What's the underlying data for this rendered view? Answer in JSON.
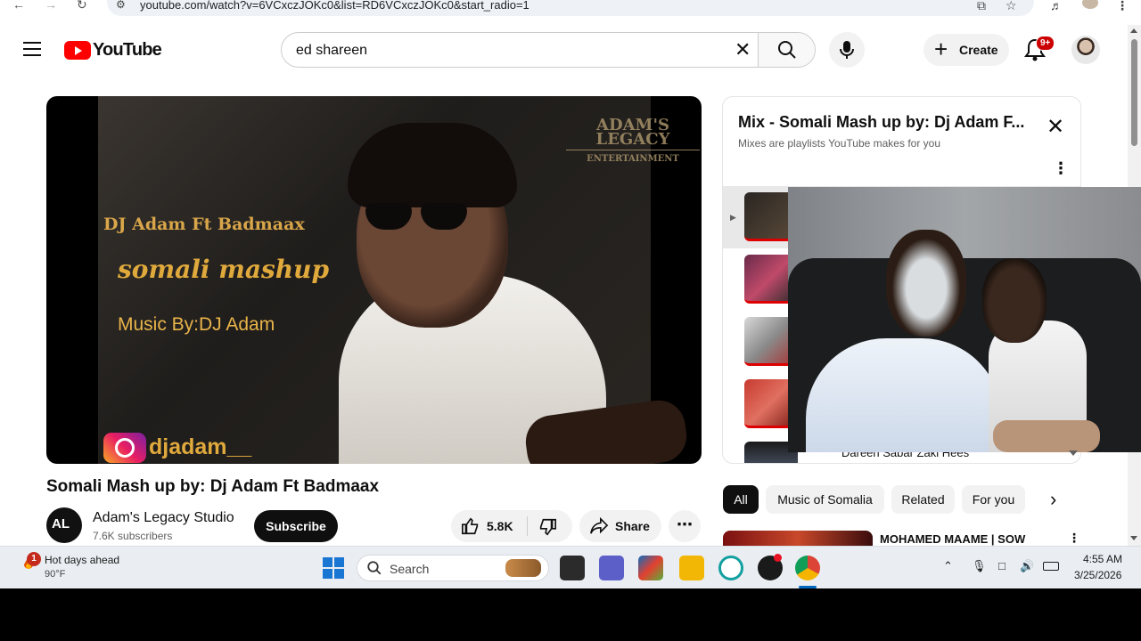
{
  "browser": {
    "url": "youtube.com/watch?v=6VCxczJOKc0&list=RD6VCxczJOKc0&start_radio=1"
  },
  "header": {
    "logo_text": "YouTube",
    "search_value": "ed shareen",
    "create_label": "Create",
    "notifications_badge": "9+"
  },
  "video": {
    "overlay_line1": "DJ Adam Ft Badmaax",
    "overlay_line2": "somali mashup",
    "overlay_line3": "Music By:DJ Adam",
    "watermark_line1": "ADAM'S LEGACY",
    "watermark_line2": "ENTERTAINMENT",
    "instagram_handle": "djadam__",
    "title": "Somali Mash up by: Dj Adam Ft Badmaax",
    "channel_name": "Adam's Legacy Studio",
    "channel_initials": "AL",
    "subscribers": "7.6K subscribers",
    "subscribe_label": "Subscribe",
    "likes": "5.8K",
    "share_label": "Share"
  },
  "playlist": {
    "title": "Mix - Somali Mash up by: Dj Adam F...",
    "subtitle": "Mixes are playlists YouTube makes for you",
    "peek_text": "Dareen Sabar Zaki Hees"
  },
  "chips": [
    "All",
    "Music of Somalia",
    "Related",
    "For you"
  ],
  "recommendation": {
    "title": "MOHAMED MAAME | SOW"
  },
  "taskbar": {
    "weather_title": "Hot days ahead",
    "weather_temp": "90°F",
    "weather_badge": "1",
    "search_label": "Search",
    "time": "4:55 AM",
    "date": "3/25/2026"
  }
}
